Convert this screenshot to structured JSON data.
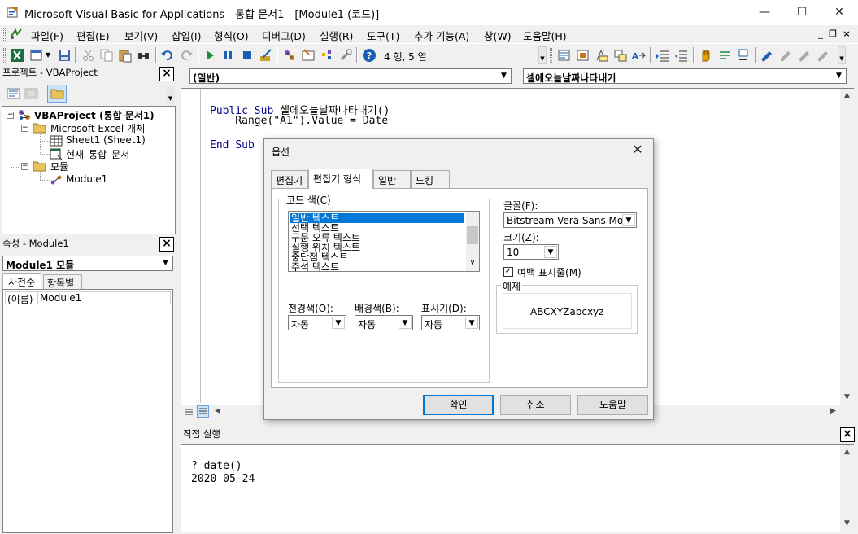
{
  "window": {
    "title": "Microsoft Visual Basic for Applications - 통합 문서1 - [Module1 (코드)]",
    "minimize": "—",
    "maximize": "☐",
    "close": "✕"
  },
  "menu": {
    "items": [
      "파일(F)",
      "편집(E)",
      "보기(V)",
      "삽입(I)",
      "형식(O)",
      "디버그(D)",
      "실행(R)",
      "도구(T)",
      "추가 기능(A)",
      "창(W)",
      "도움말(H)"
    ],
    "mdi_min": "_",
    "mdi_restore": "❐",
    "mdi_close": "×"
  },
  "toolbar": {
    "position": "4 행, 5 열"
  },
  "project_pane": {
    "title": "프로젝트 - VBAProject",
    "close": "×",
    "tree": {
      "root": "VBAProject (통합 문서1)",
      "excel_folder": "Microsoft Excel 개체",
      "sheet1": "Sheet1 (Sheet1)",
      "workbook": "현재_통합_문서",
      "modules_folder": "모듈",
      "module1": "Module1"
    }
  },
  "props_pane": {
    "title": "속성 - Module1",
    "close": "×",
    "object_combo": "Module1 모듈",
    "tabs": [
      "사전순",
      "항목별"
    ],
    "row_name": "(이름)",
    "row_value": "Module1"
  },
  "code_window": {
    "object_combo": "(일반)",
    "proc_combo": "셀에오늘날짜나타내기",
    "lines": [
      {
        "kw": "Public Sub",
        "text": " 셀에오늘날짜나타내기()"
      },
      {
        "kw": "",
        "text": "    Range(\"A1\").Value = Date"
      },
      {
        "kw": "End Sub",
        "text": ""
      }
    ]
  },
  "immediate": {
    "title": "직접 실행",
    "close": "×",
    "lines": [
      "? date()",
      "2020-05-24"
    ]
  },
  "dialog": {
    "title": "옵션",
    "close": "✕",
    "tabs": [
      "편집기",
      "편집기 형식",
      "일반",
      "도킹"
    ],
    "active_tab": "편집기 형식",
    "code_colors_label": "코드 색(C)",
    "code_colors": [
      "일반 텍스트",
      "선택 텍스트",
      "구문 오류 텍스트",
      "실행 위치 텍스트",
      "중단점 텍스트",
      "주석 텍스트"
    ],
    "selected_color": "일반 텍스트",
    "foreground_label": "전경색(O):",
    "background_label": "배경색(B):",
    "indicator_label": "표시기(D):",
    "foreground_value": "자동",
    "background_value": "자동",
    "indicator_value": "자동",
    "font_label": "글꼴(F):",
    "font_value": "Bitstream Vera Sans Mor",
    "size_label": "크기(Z):",
    "size_value": "10",
    "margin_checkbox": "여백 표시줄(M)",
    "margin_checked": true,
    "sample_label": "예제",
    "sample_text": "ABCXYZabcxyz",
    "ok": "확인",
    "cancel": "취소",
    "help": "도움말"
  },
  "colors": {
    "selection": "#0078d7",
    "keyword": "#00008b"
  }
}
